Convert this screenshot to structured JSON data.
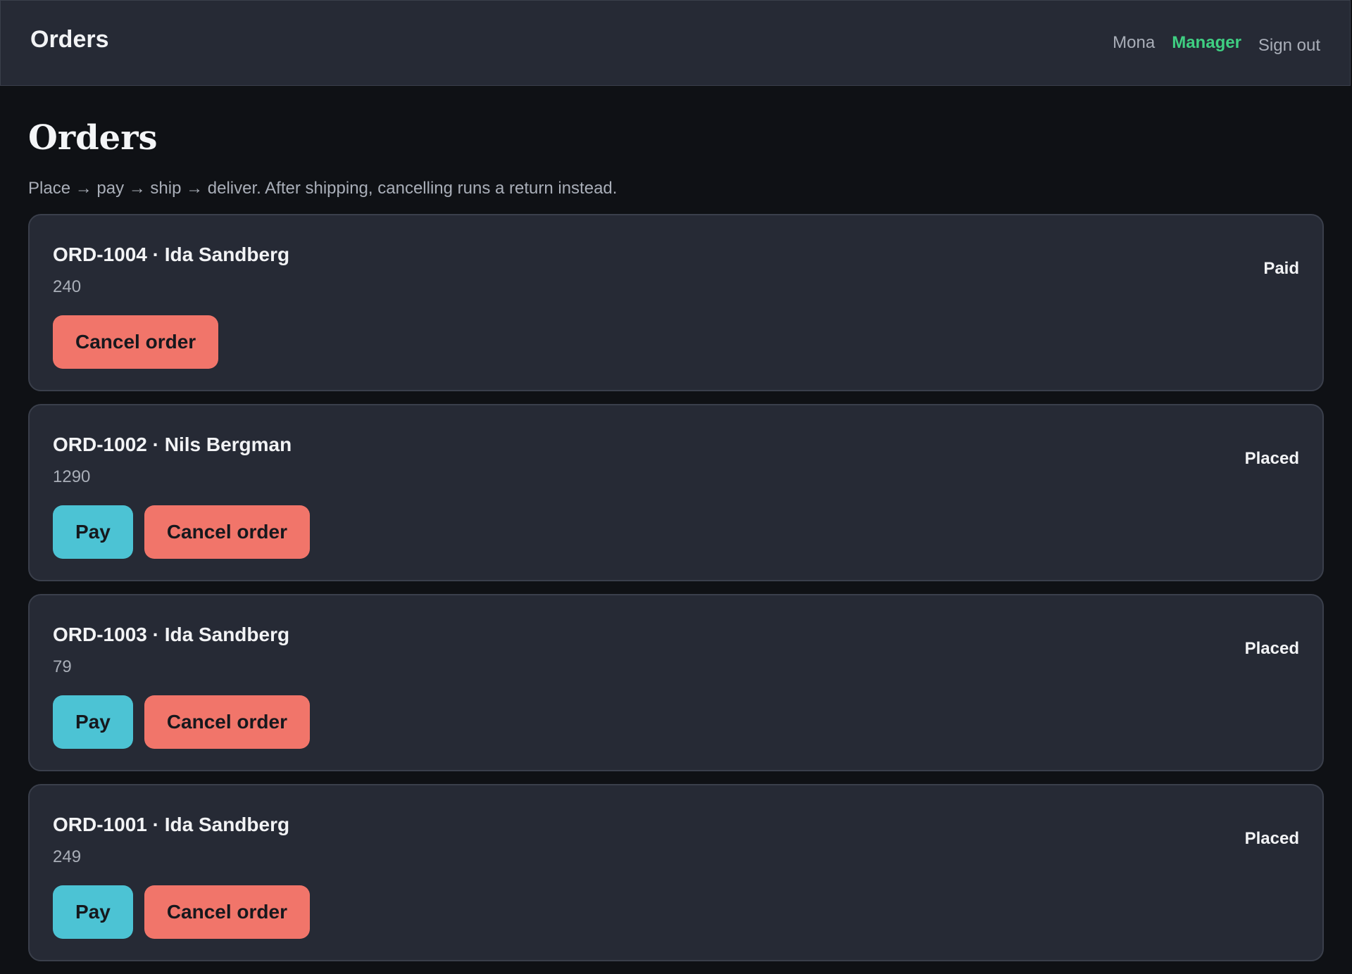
{
  "header": {
    "app_title": "Orders",
    "user_name": "Mona",
    "role": "Manager",
    "sign_out_label": "Sign out"
  },
  "page": {
    "title": "Orders",
    "subtitle": "Place → pay → ship → deliver. After shipping, cancelling runs a return instead."
  },
  "buttons": {
    "pay_label": "Pay",
    "cancel_label": "Cancel order"
  },
  "orders": [
    {
      "title": "ORD-1004 · Ida Sandberg",
      "amount": "240",
      "status": "Paid",
      "can_pay": false
    },
    {
      "title": "ORD-1002 · Nils Bergman",
      "amount": "1290",
      "status": "Placed",
      "can_pay": true
    },
    {
      "title": "ORD-1003 · Ida Sandberg",
      "amount": "79",
      "status": "Placed",
      "can_pay": true
    },
    {
      "title": "ORD-1001 · Ida Sandberg",
      "amount": "249",
      "status": "Placed",
      "can_pay": true
    }
  ],
  "colors": {
    "background": "#0f1115",
    "surface": "#262a35",
    "accent_role": "#3fcf82",
    "pay_button": "#4cc3d4",
    "cancel_button": "#f1756a"
  }
}
